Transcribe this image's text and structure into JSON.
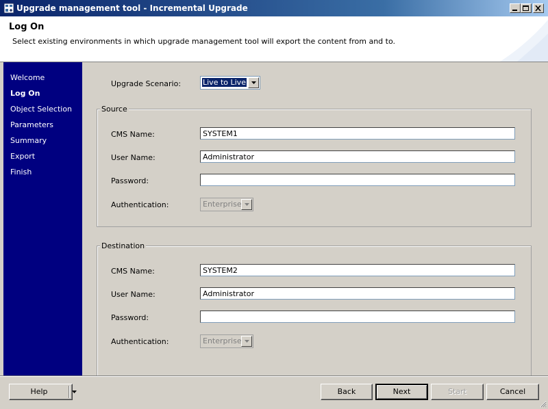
{
  "window": {
    "title": "Upgrade management tool - Incremental Upgrade"
  },
  "header": {
    "title": "Log On",
    "subtitle": "Select existing environments in which upgrade management tool will export the content from and to."
  },
  "sidebar": {
    "items": [
      {
        "label": "Welcome"
      },
      {
        "label": "Log On"
      },
      {
        "label": "Object Selection"
      },
      {
        "label": "Parameters"
      },
      {
        "label": "Summary"
      },
      {
        "label": "Export"
      },
      {
        "label": "Finish"
      }
    ]
  },
  "scenario": {
    "label": "Upgrade Scenario:",
    "value": "Live to Live"
  },
  "source": {
    "legend": "Source",
    "cms_label": "CMS Name:",
    "cms_value": "SYSTEM1",
    "user_label": "User Name:",
    "user_value": "Administrator",
    "password_label": "Password:",
    "password_value": "",
    "auth_label": "Authentication:",
    "auth_value": "Enterprise"
  },
  "destination": {
    "legend": "Destination",
    "cms_label": "CMS Name:",
    "cms_value": "SYSTEM2",
    "user_label": "User Name:",
    "user_value": "Administrator",
    "password_label": "Password:",
    "password_value": "",
    "auth_label": "Authentication:",
    "auth_value": "Enterprise"
  },
  "buttons": {
    "help": "Help",
    "back": "Back",
    "next": "Next",
    "start": "Start",
    "cancel": "Cancel"
  },
  "colors": {
    "sidebar": "#000080",
    "titlebar": "#0a246a",
    "face": "#d4d0c8"
  }
}
